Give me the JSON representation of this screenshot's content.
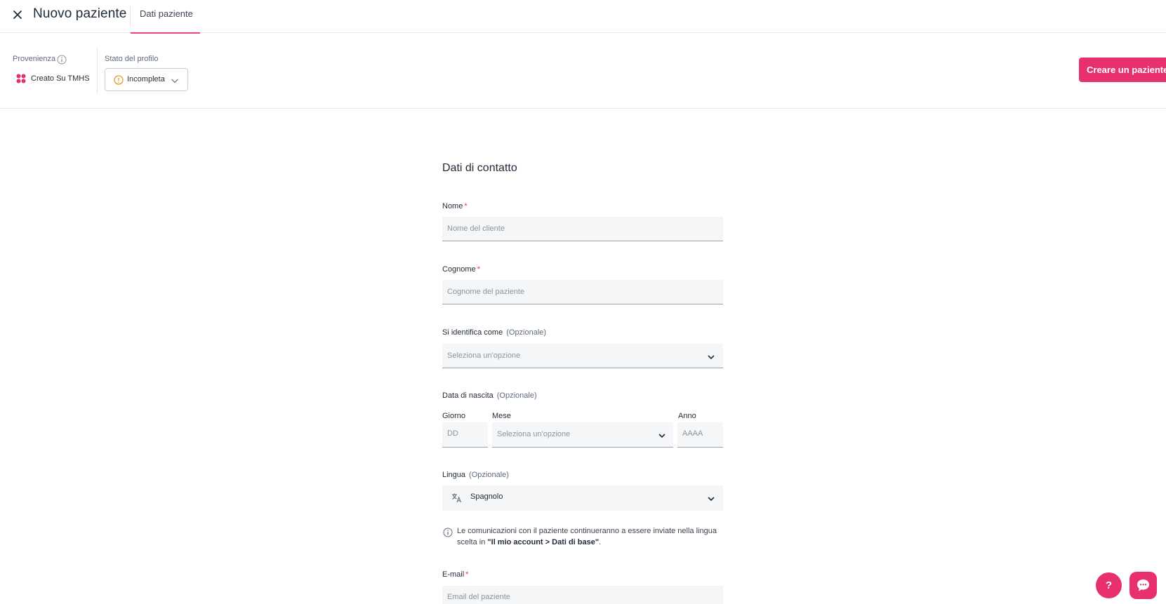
{
  "header": {
    "title": "Nuovo paziente",
    "tab_label": "Dati paziente"
  },
  "profile": {
    "provenance_label": "Provenienza",
    "provenance_value": "Creato Su TMHS",
    "status_label": "Stato del profilo",
    "status_value": "Incompleta"
  },
  "actions": {
    "create_label": "Creare un paziente"
  },
  "form": {
    "section_title": "Dati di contatto",
    "required_mark": "*",
    "nome": {
      "label": "Nome",
      "placeholder": "Nome del cliente"
    },
    "cognome": {
      "label": "Cognome",
      "placeholder": "Cognome del paziente"
    },
    "identifica": {
      "label": "Si identifica come",
      "optional": "(Opzionale)",
      "placeholder": "Seleziona un'opzione"
    },
    "nascita": {
      "label": "Data di nascita",
      "optional": "(Opzionale)",
      "giorno_label": "Giorno",
      "giorno_placeholder": "DD",
      "mese_label": "Mese",
      "mese_placeholder": "Seleziona un'opzione",
      "anno_label": "Anno",
      "anno_placeholder": "AAAA"
    },
    "lingua": {
      "label": "Lingua",
      "optional": "(Opzionale)",
      "value": "Spagnolo"
    },
    "note": {
      "text": "Le comunicazioni con il paziente continueranno a essere inviate nella lingua scelta in ",
      "bold": "\"Il mio account > Dati di base\"",
      "end": "."
    },
    "email": {
      "label": "E-mail",
      "placeholder": "Email del paziente"
    }
  },
  "floating": {
    "help_label": "?"
  },
  "colors": {
    "accent": "#e8306f",
    "status_warning": "#e8962a"
  }
}
